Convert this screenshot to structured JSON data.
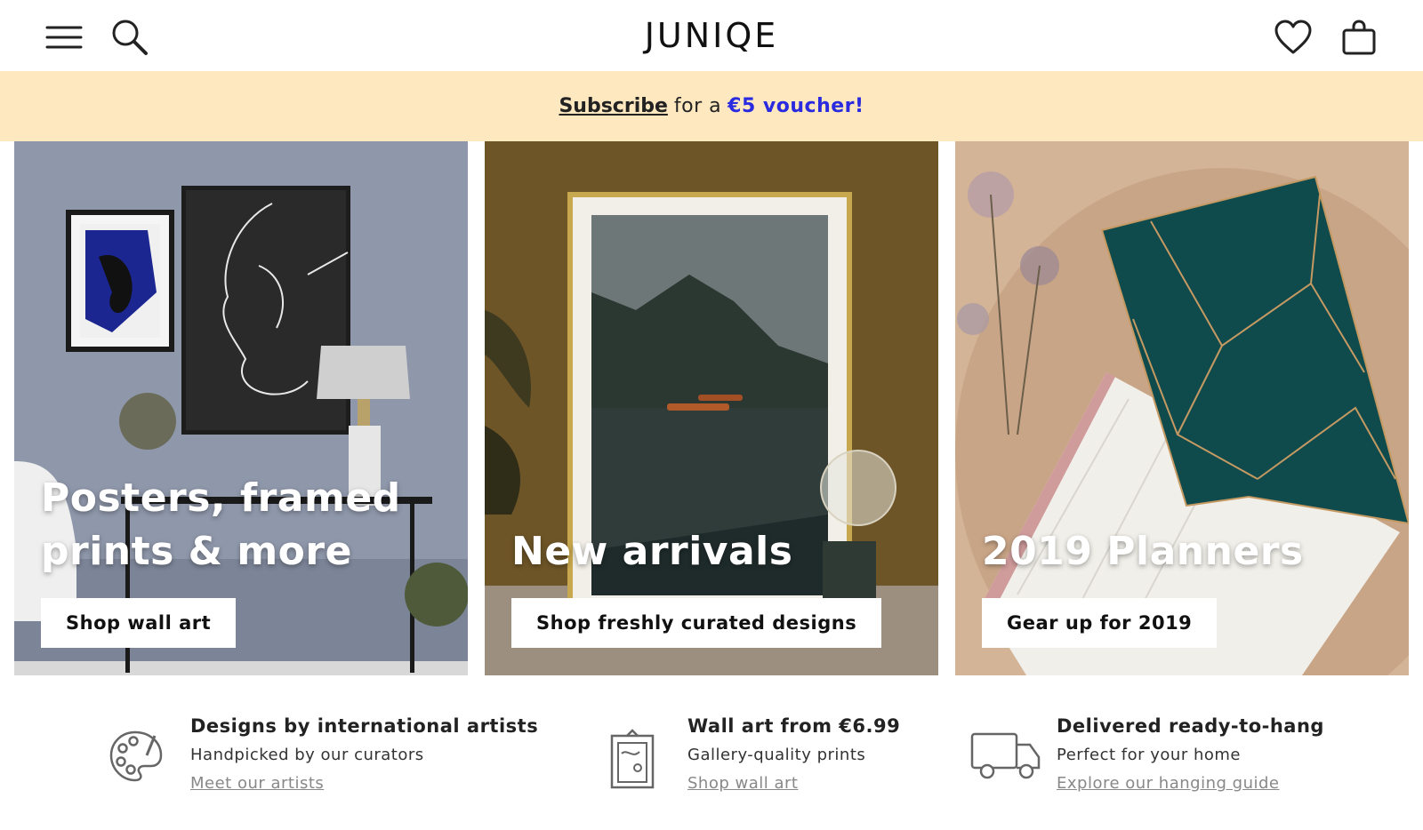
{
  "header": {
    "logo": "JUNIQE",
    "icons": {
      "menu": "hamburger-menu-icon",
      "search": "search-icon",
      "wishlist": "heart-icon",
      "cart": "shopping-bag-icon"
    }
  },
  "promo": {
    "link_text": "Subscribe",
    "middle_text": "for a",
    "voucher_text": "€5 voucher!",
    "background": "#fde8c0",
    "voucher_color": "#2a2ae0"
  },
  "tiles": [
    {
      "title_line1": "Posters, framed",
      "title_line2": "prints & more",
      "button": "Shop wall art"
    },
    {
      "title_line1": "New arrivals",
      "button": "Shop freshly curated designs"
    },
    {
      "title_line1": "2019 Planners",
      "button": "Gear up for 2019"
    }
  ],
  "features": [
    {
      "icon": "palette-icon",
      "title": "Designs by international artists",
      "subtitle": "Handpicked by our curators",
      "link": "Meet our artists"
    },
    {
      "icon": "framed-print-icon",
      "title": "Wall art from €6.99",
      "subtitle": "Gallery-quality prints",
      "link": "Shop wall art"
    },
    {
      "icon": "delivery-truck-icon",
      "title": "Delivered ready-to-hang",
      "subtitle": "Perfect for your home",
      "link": "Explore our hanging guide"
    }
  ]
}
